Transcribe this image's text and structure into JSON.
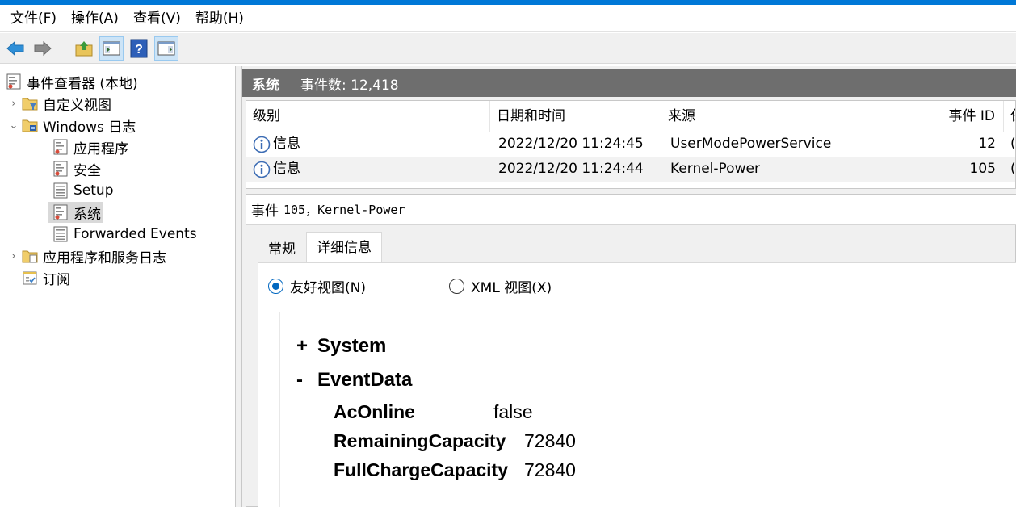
{
  "menu": [
    "文件(F)",
    "操作(A)",
    "查看(V)",
    "帮助(H)"
  ],
  "tree": {
    "root": "事件查看器 (本地)",
    "custom_views": "自定义视图",
    "windows_logs": "Windows 日志",
    "application": "应用程序",
    "security": "安全",
    "setup": "Setup",
    "system": "系统",
    "forwarded": "Forwarded Events",
    "app_services": "应用程序和服务日志",
    "subscriptions": "订阅"
  },
  "header": {
    "log_name": "系统",
    "event_count": "事件数: 12,418"
  },
  "grid": {
    "columns": [
      "级别",
      "日期和时间",
      "来源",
      "事件 ID",
      "任"
    ],
    "rows": [
      {
        "level": "信息",
        "datetime": "2022/12/20 11:24:45",
        "source": "UserModePowerService",
        "event_id": "12",
        "task": "("
      },
      {
        "level": "信息",
        "datetime": "2022/12/20 11:24:44",
        "source": "Kernel-Power",
        "event_id": "105",
        "task": "("
      }
    ]
  },
  "detail": {
    "title_prefix": "事件",
    "title_rest": "105，Kernel-Power",
    "tabs": [
      "常规",
      "详细信息"
    ],
    "radio_friendly": "友好视图(N)",
    "radio_xml": "XML 视图(X)",
    "section_system": "System",
    "section_system_sign": "+",
    "section_eventdata": "EventData",
    "section_eventdata_sign": "-",
    "fields": [
      {
        "key": "AcOnline",
        "value": "false"
      },
      {
        "key": "RemainingCapacity",
        "value": "72840"
      },
      {
        "key": "FullChargeCapacity",
        "value": "72840"
      }
    ]
  }
}
